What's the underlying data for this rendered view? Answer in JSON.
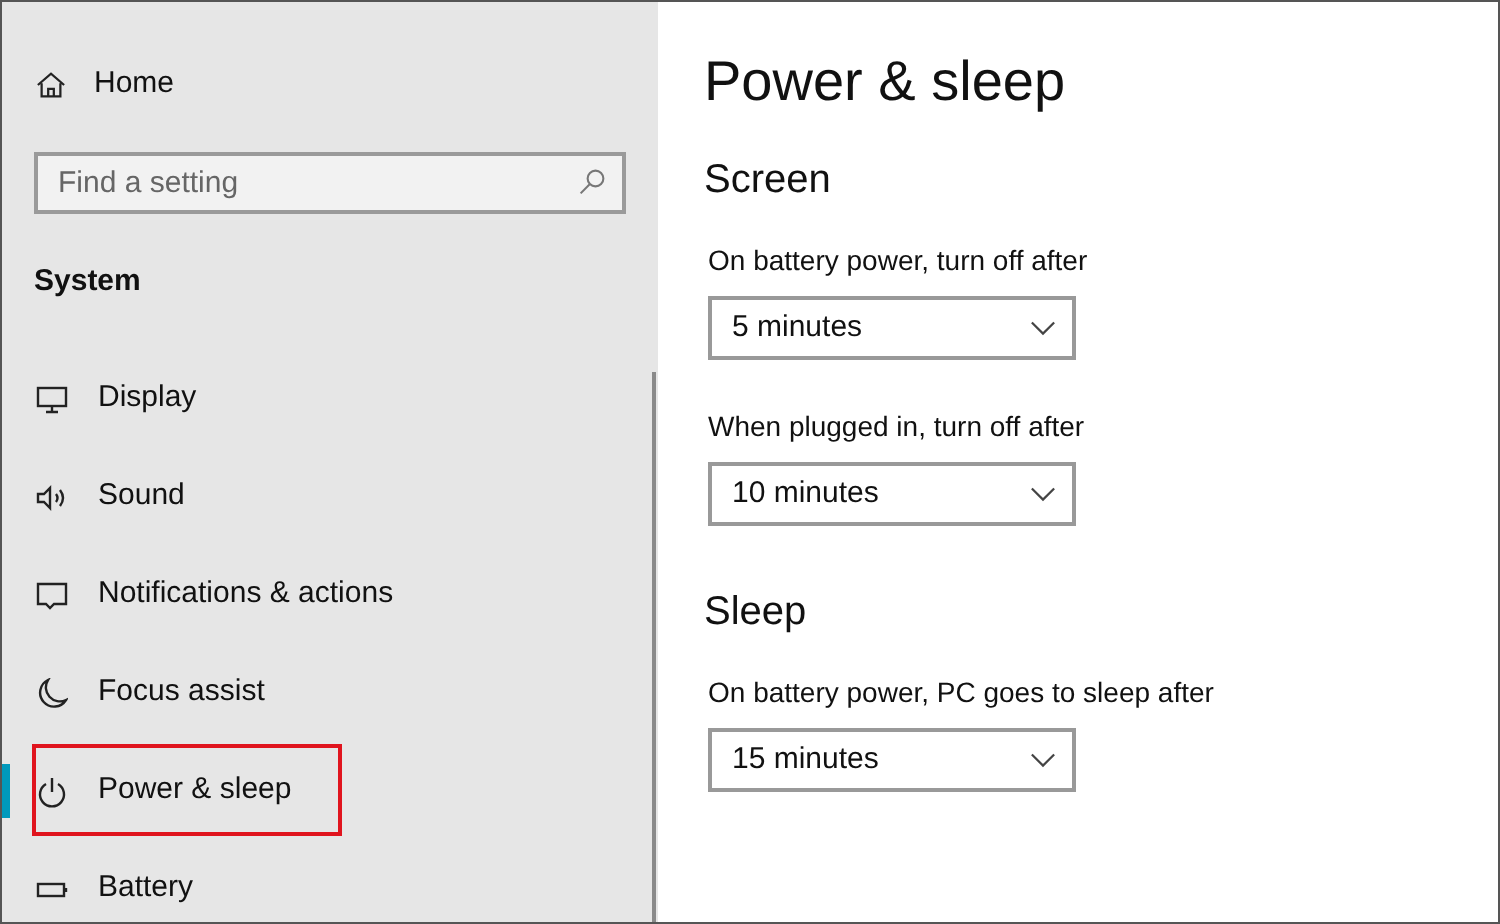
{
  "sidebar": {
    "home": "Home",
    "search": {
      "placeholder": "Find a setting"
    },
    "section": "System",
    "items": [
      {
        "label": "Display",
        "selected": false,
        "annotated": false
      },
      {
        "label": "Sound",
        "selected": false,
        "annotated": false
      },
      {
        "label": "Notifications & actions",
        "selected": false,
        "annotated": false
      },
      {
        "label": "Focus assist",
        "selected": false,
        "annotated": false
      },
      {
        "label": "Power & sleep",
        "selected": true,
        "annotated": true
      },
      {
        "label": "Battery",
        "selected": false,
        "annotated": false
      }
    ]
  },
  "page": {
    "title": "Power & sleep",
    "sections": [
      {
        "heading": "Screen",
        "settings": [
          {
            "label": "On battery power, turn off after",
            "value": "5 minutes"
          },
          {
            "label": "When plugged in, turn off after",
            "value": "10 minutes"
          }
        ]
      },
      {
        "heading": "Sleep",
        "settings": [
          {
            "label": "On battery power, PC goes to sleep after",
            "value": "15 minutes"
          }
        ]
      }
    ]
  }
}
